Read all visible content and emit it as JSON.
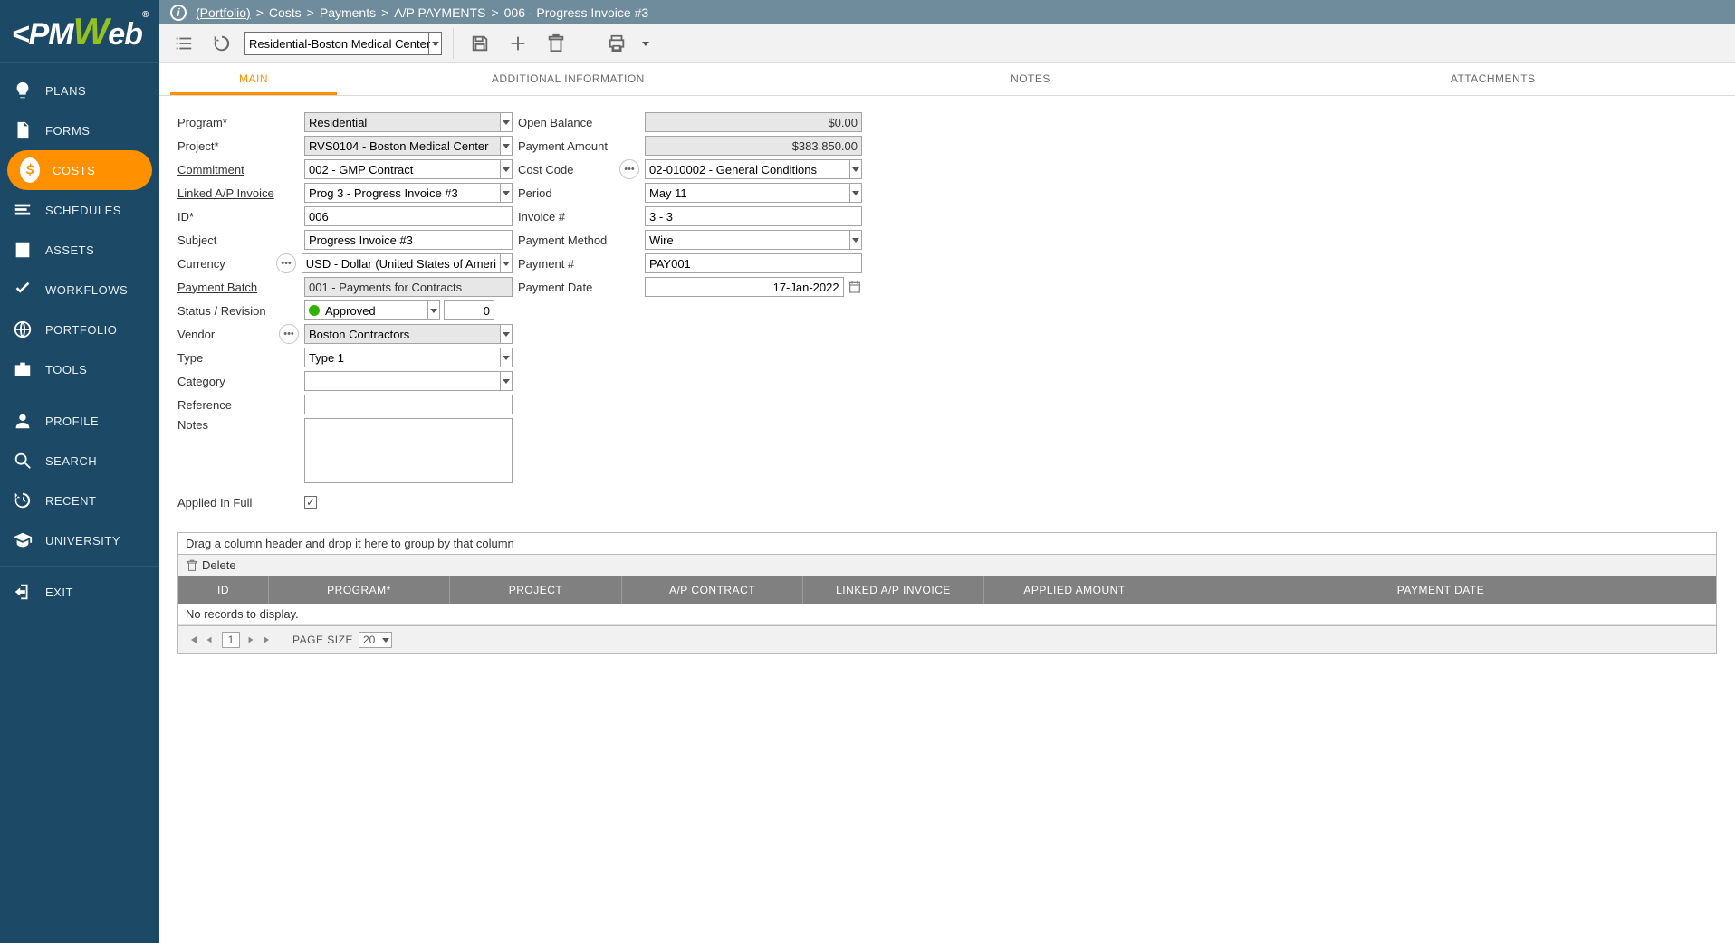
{
  "app_name": "PMWeb",
  "breadcrumb": {
    "portfolio": "(Portfolio)",
    "parts": [
      "Costs",
      "Payments",
      "A/P PAYMENTS",
      "006 - Progress Invoice #3"
    ]
  },
  "toolbar": {
    "project_selector": "Residential-Boston Medical Center - "
  },
  "sidebar": {
    "items": [
      {
        "label": "PLANS",
        "icon": "lightbulb"
      },
      {
        "label": "FORMS",
        "icon": "page"
      },
      {
        "label": "COSTS",
        "icon": "dollar",
        "active": true
      },
      {
        "label": "SCHEDULES",
        "icon": "bars"
      },
      {
        "label": "ASSETS",
        "icon": "building"
      },
      {
        "label": "WORKFLOWS",
        "icon": "check"
      },
      {
        "label": "PORTFOLIO",
        "icon": "globe"
      },
      {
        "label": "TOOLS",
        "icon": "briefcase"
      }
    ],
    "footer_items": [
      {
        "label": "PROFILE",
        "icon": "user"
      },
      {
        "label": "SEARCH",
        "icon": "search"
      },
      {
        "label": "RECENT",
        "icon": "history"
      },
      {
        "label": "UNIVERSITY",
        "icon": "gradcap"
      },
      {
        "label": "EXIT",
        "icon": "exit"
      }
    ]
  },
  "tabs": [
    "MAIN",
    "ADDITIONAL INFORMATION",
    "NOTES",
    "ATTACHMENTS"
  ],
  "form": {
    "left": {
      "program_label": "Program*",
      "program": "Residential",
      "project_label": "Project*",
      "project": "RVS0104 - Boston Medical Center",
      "commitment_label": "Commitment",
      "commitment": "002 - GMP Contract",
      "linked_ap_label": "Linked A/P Invoice",
      "linked_ap": "Prog 3 - Progress Invoice #3",
      "id_label": "ID*",
      "id": "006",
      "subject_label": "Subject",
      "subject": "Progress Invoice #3",
      "currency_label": "Currency",
      "currency": "USD - Dollar (United States of Ameri",
      "payment_batch_label": "Payment Batch",
      "payment_batch": "001 - Payments for Contracts",
      "status_label": "Status / Revision",
      "status": "Approved",
      "revision": "0",
      "vendor_label": "Vendor",
      "vendor": "Boston Contractors",
      "type_label": "Type",
      "type": "Type 1",
      "category_label": "Category",
      "category": "",
      "reference_label": "Reference",
      "reference": "",
      "notes_label": "Notes",
      "notes": "",
      "applied_in_full_label": "Applied In Full",
      "applied_in_full": true
    },
    "right": {
      "open_balance_label": "Open Balance",
      "open_balance": "$0.00",
      "payment_amount_label": "Payment Amount",
      "payment_amount": "$383,850.00",
      "cost_code_label": "Cost Code",
      "cost_code": "02-010002 - General Conditions",
      "period_label": "Period",
      "period": "May 11",
      "invoice_num_label": "Invoice #",
      "invoice_num": "3 - 3",
      "payment_method_label": "Payment Method",
      "payment_method": "Wire",
      "payment_num_label": "Payment #",
      "payment_num": "PAY001",
      "payment_date_label": "Payment Date",
      "payment_date": "17-Jan-2022"
    }
  },
  "grid": {
    "group_hint": "Drag a column header and drop it here to group by that column",
    "delete_label": "Delete",
    "columns": [
      "ID",
      "PROGRAM*",
      "PROJECT",
      "A/P CONTRACT",
      "LINKED A/P INVOICE",
      "APPLIED AMOUNT",
      "PAYMENT DATE"
    ],
    "empty": "No records to display.",
    "pager": {
      "current": "1",
      "page_size_label": "PAGE SIZE",
      "page_size": "20"
    }
  }
}
